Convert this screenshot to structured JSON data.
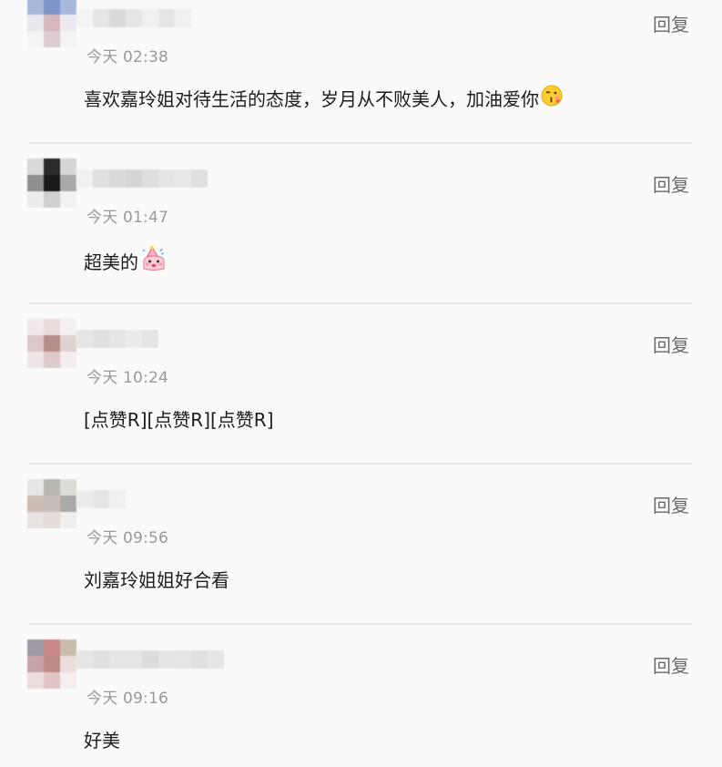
{
  "comments": [
    {
      "time": "今天 02:38",
      "text": "喜欢嘉玲姐对待生活的态度，岁月从不败美人，加油爱你",
      "reply_label": "回复",
      "emoji": "kissing-face-icon",
      "avatar_colors": [
        "#a8b8dc",
        "#7f95c9",
        "#a8b8dc",
        "#e8e8ee",
        "#d7b6be",
        "#eceaf0",
        "#f4f4f6",
        "#dccbd0",
        "#f4f4f6"
      ],
      "name_colors": [
        "#f4f4f4",
        "#e6e6e6",
        "#d9d9d9",
        "#e6e6e6",
        "#f0f0f0",
        "#e6e6e6",
        "#f0f0f0"
      ]
    },
    {
      "time": "今天 01:47",
      "text": "超美的",
      "reply_label": "回复",
      "emoji": "party-face-icon",
      "avatar_colors": [
        "#d9d9d9",
        "#2b2b2b",
        "#d6d6d6",
        "#8f8f8f",
        "#1a1a1a",
        "#a9a9a9",
        "#ececec",
        "#cfcfcf",
        "#f2f2f2"
      ],
      "name_colors": [
        "#f0f0f0",
        "#e0e0e0",
        "#dadada",
        "#d4d4d4",
        "#dedede",
        "#e4e4e4",
        "#e8e8e8",
        "#e0e0e0"
      ]
    },
    {
      "time": "今天 10:24",
      "text": "[点赞R][点赞R][点赞R]",
      "reply_label": "回复",
      "emoji": "",
      "avatar_colors": [
        "#f2eaea",
        "#e8dcdc",
        "#f4f0f0",
        "#dcc8c6",
        "#b88c8a",
        "#e0d2d0",
        "#eee6e6",
        "#dccaca",
        "#f2eeee"
      ],
      "name_colors": [
        "#e6e6e6",
        "#e0e0e0",
        "#e6e6e6",
        "#ebebeb",
        "#e4e4e4"
      ]
    },
    {
      "time": "今天 09:56",
      "text": "刘嘉玲姐姐好合看",
      "reply_label": "回复",
      "emoji": "",
      "avatar_colors": [
        "#e6e6e6",
        "#b8b8b0",
        "#dcdcd8",
        "#cbbcb4",
        "#c8beb8",
        "#aaaaa8",
        "#e8e2e0",
        "#e4dcd8",
        "#eeeeee"
      ],
      "name_colors": [
        "#ececec",
        "#e6e6e6",
        "#f0f0f0"
      ]
    },
    {
      "time": "今天 09:16",
      "text": "好美",
      "reply_label": "回复",
      "emoji": "",
      "avatar_colors": [
        "#9f9aa6",
        "#c88a86",
        "#cbbca8",
        "#c6a4a6",
        "#c08a86",
        "#ecdcdc",
        "#ecdcdc",
        "#e2c4c4",
        "#f4eeee"
      ],
      "name_colors": [
        "#e6e6e6",
        "#e0e0e0",
        "#e6e6e6",
        "#e6e6e6",
        "#dcdcdc",
        "#e4e4e4",
        "#e6e6e6",
        "#e0e0e0",
        "#e6e6e6"
      ]
    }
  ]
}
